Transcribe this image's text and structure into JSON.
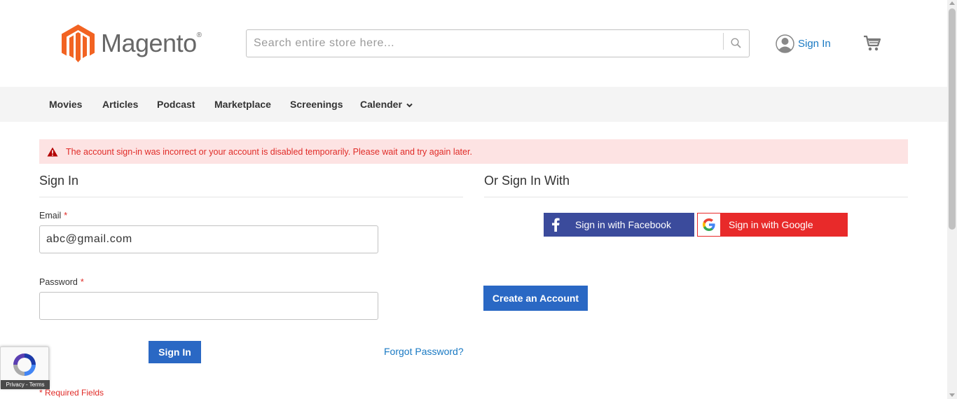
{
  "brand": {
    "name": "Magento",
    "reg_mark": "®",
    "logo_color": "#f26322"
  },
  "search": {
    "placeholder": "Search entire store here...",
    "value": ""
  },
  "header": {
    "signin_label": "Sign In"
  },
  "nav": {
    "items": [
      "Movies",
      "Articles",
      "Podcast",
      "Marketplace",
      "Screenings",
      "Calender"
    ]
  },
  "message": {
    "type": "error",
    "text": "The account sign-in was incorrect or your account is disabled temporarily. Please wait and try again later."
  },
  "signin": {
    "title": "Sign In",
    "email_label": "Email",
    "email_value": "abc@gmail.com",
    "password_label": "Password",
    "password_value": "",
    "required_mark": "*",
    "submit_label": "Sign In",
    "forgot_label": "Forgot Password?",
    "required_note": "* Required Fields"
  },
  "social": {
    "title": "Or Sign In With",
    "facebook_label": "Sign in with Facebook",
    "google_label": "Sign in with Google",
    "create_account_label": "Create an Account"
  },
  "recaptcha": {
    "text": "Privacy - Terms"
  },
  "colors": {
    "accent": "#2a68c4",
    "link": "#1979c3",
    "error": "#e02b27",
    "facebook": "#3b4b9c",
    "google": "#e82a2a"
  }
}
